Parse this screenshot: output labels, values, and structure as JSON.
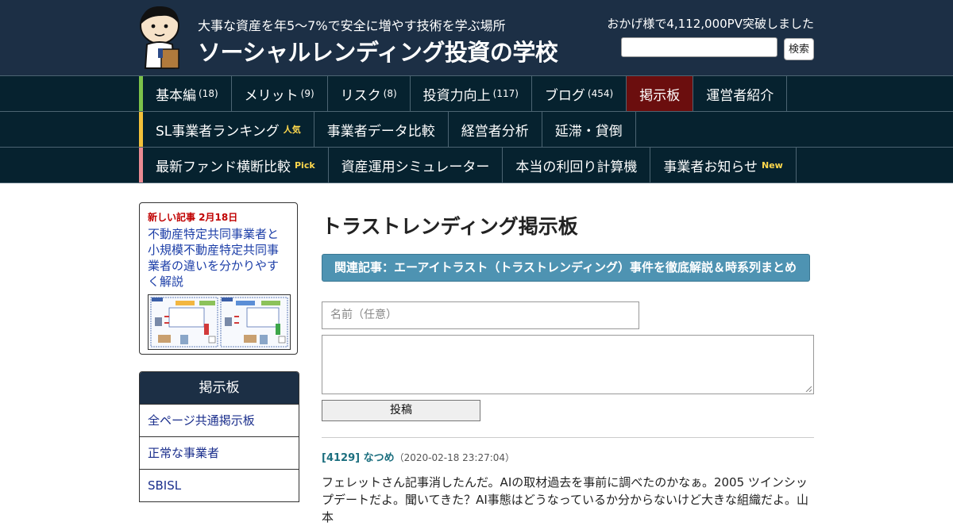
{
  "header": {
    "tagline": "大事な資産を年5～7%で安全に増やす技術を学ぶ場所",
    "title": "ソーシャルレンディング投資の学校",
    "pv_text": "おかげ様で4,112,000PV突破しました",
    "search_button": "検索",
    "search_value": ""
  },
  "nav": {
    "rows": [
      {
        "accent": "#7cc24a",
        "items": [
          {
            "label": "基本編",
            "count": "(18)"
          },
          {
            "label": "メリット",
            "count": "(9)"
          },
          {
            "label": "リスク",
            "count": "(8)"
          },
          {
            "label": "投資力向上",
            "count": "(117)"
          },
          {
            "label": "ブログ",
            "count": "(454)"
          },
          {
            "label": "掲示板",
            "active": true
          },
          {
            "label": "運営者紹介"
          }
        ]
      },
      {
        "accent": "#f2c13a",
        "items": [
          {
            "label": "SL事業者ランキング",
            "tag": "人気"
          },
          {
            "label": "事業者データ比較"
          },
          {
            "label": "経営者分析"
          },
          {
            "label": "延滞・貸倒"
          }
        ]
      },
      {
        "accent": "#e98a92",
        "items": [
          {
            "label": "最新ファンド横断比較",
            "tag": "Pick"
          },
          {
            "label": "資産運用シミュレーター"
          },
          {
            "label": "本当の利回り計算機"
          },
          {
            "label": "事業者お知らせ",
            "tag": "New"
          }
        ]
      }
    ]
  },
  "sidebar": {
    "new_article_date": "新しい記事 2月18日",
    "new_article_title": "不動産特定共同事業者と小規模不動産特定共同事業者の違いを分かりやすく解説",
    "bbs_title": "掲示板",
    "bbs_items": [
      "全ページ共通掲示板",
      "正常な事業者",
      "SBISL"
    ]
  },
  "main": {
    "title": "トラストレンディング掲示板",
    "related": "関連記事：エーアイトラスト（トラストレンディング）事件を徹底解説＆時系列まとめ",
    "name_placeholder": "名前（任意）",
    "post_button": "投稿",
    "post": {
      "id_name": "[4129] なつめ",
      "date": "（2020-02-18 23:27:04）",
      "body": "フェレットさん記事消したんだ。AIの取材過去を事前に調べたのかなぁ。2005 ツインシップデートだよ。聞いてきた？AI事態はどうなっているか分からないけど大きな組織だよ。山本"
    }
  }
}
